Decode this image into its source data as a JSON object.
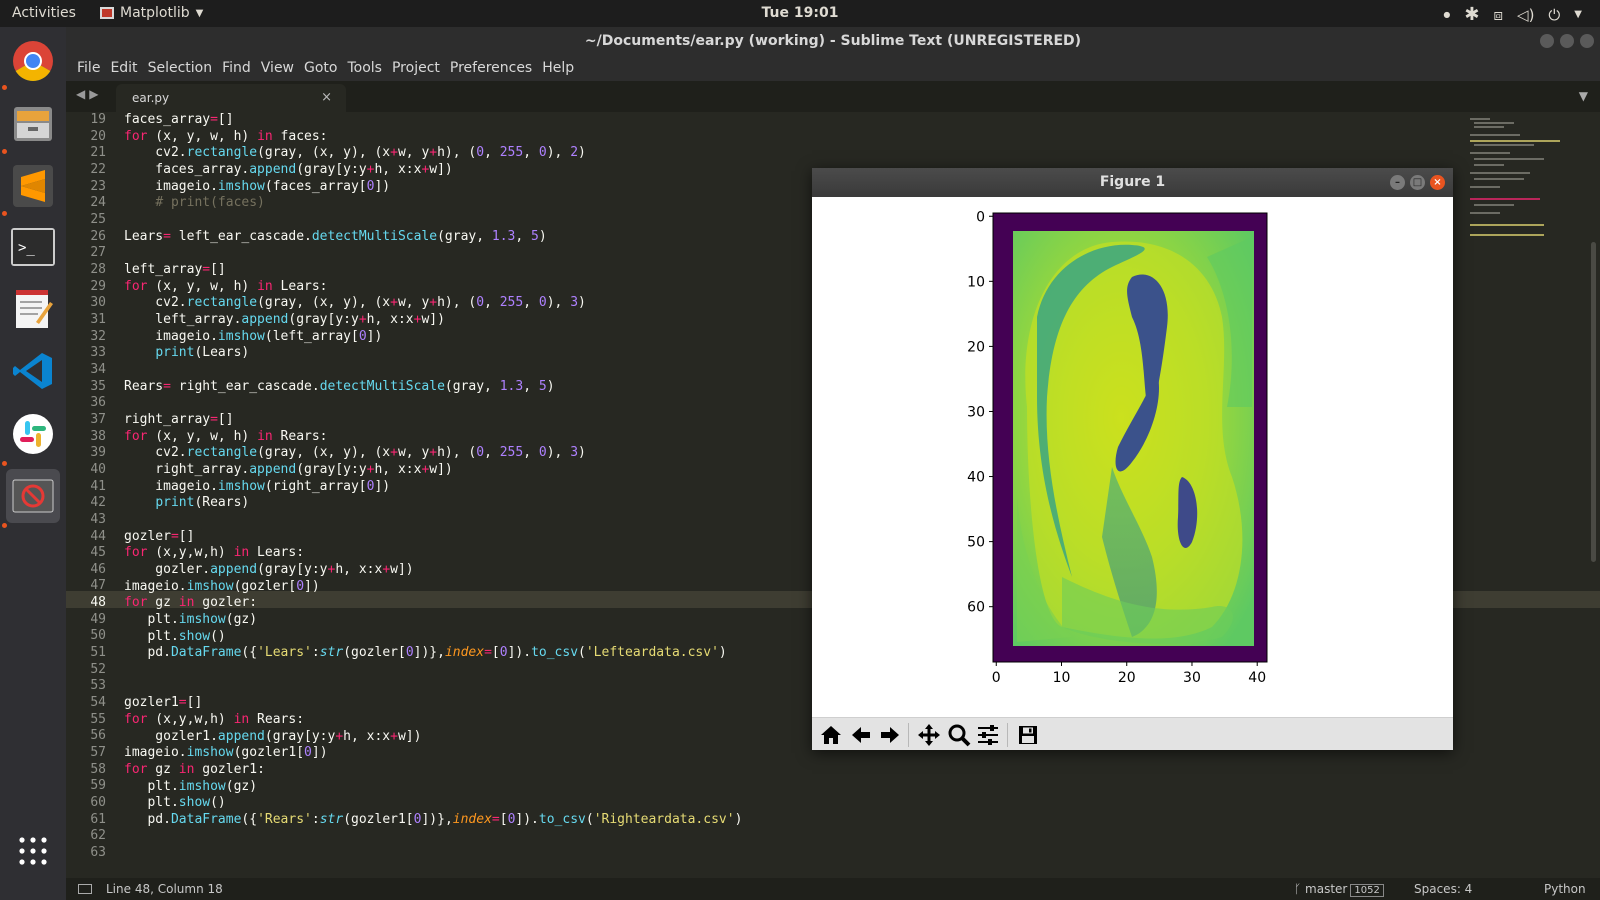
{
  "topbar": {
    "activities": "Activities",
    "app_name": "Matplotlib",
    "clock": "Tue 19:01"
  },
  "dock": {
    "apps": [
      "chrome-icon",
      "files-icon",
      "sublime-text-icon",
      "terminal-icon",
      "text-editor-icon",
      "vscode-icon",
      "slack-icon",
      "matplotlib-figure-icon"
    ],
    "show_apps_icon": "grid-icon"
  },
  "window": {
    "title": "~/Documents/ear.py (working) - Sublime Text (UNREGISTERED)"
  },
  "menu": {
    "items": [
      "File",
      "Edit",
      "Selection",
      "Find",
      "View",
      "Goto",
      "Tools",
      "Project",
      "Preferences",
      "Help"
    ]
  },
  "tab": {
    "name": "ear.py",
    "close": "×"
  },
  "editor": {
    "line_numbers": [
      "19",
      "20",
      "21",
      "22",
      "23",
      "24",
      "25",
      "26",
      "27",
      "28",
      "29",
      "30",
      "31",
      "32",
      "33",
      "34",
      "35",
      "36",
      "37",
      "38",
      "39",
      "40",
      "41",
      "42",
      "43",
      "44",
      "45",
      "46",
      "47",
      "48",
      "49",
      "50",
      "51",
      "52",
      "53",
      "54",
      "55",
      "56",
      "57",
      "58",
      "59",
      "60",
      "61",
      "62",
      "63"
    ],
    "current_line": "48"
  },
  "statusbar": {
    "position": "Line 48, Column 18",
    "branch": "master",
    "branch_count": "1052",
    "spaces": "Spaces: 4",
    "language": "Python"
  },
  "figure": {
    "title": "Figure 1",
    "x_ticks": [
      "0",
      "10",
      "20",
      "30",
      "40"
    ],
    "y_ticks": [
      "0",
      "10",
      "20",
      "30",
      "40",
      "50",
      "60"
    ],
    "toolbar": [
      "home-icon",
      "back-arrow-icon",
      "forward-arrow-icon",
      "pan-icon",
      "zoom-icon",
      "configure-subplots-icon",
      "save-icon"
    ]
  },
  "chart_data": {
    "type": "heatmap",
    "description": "imshow of grayscale ear image with viridis colormap",
    "xlim": [
      -0.5,
      41.5
    ],
    "ylim": [
      68.5,
      -0.5
    ],
    "x_ticks": [
      0,
      10,
      20,
      30,
      40
    ],
    "y_ticks": [
      0,
      10,
      20,
      30,
      40,
      50,
      60
    ],
    "colormap": "viridis",
    "image_width": 42,
    "image_height": 69,
    "border_value": "dark purple (min)"
  }
}
